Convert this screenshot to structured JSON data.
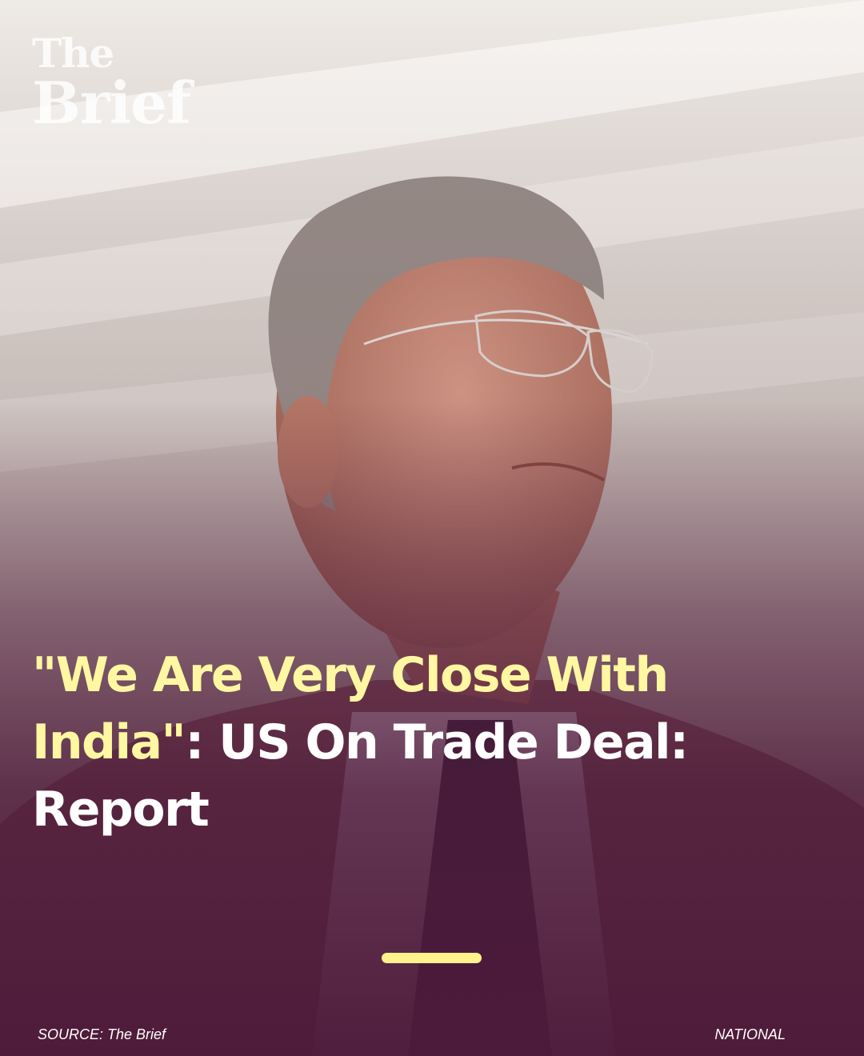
{
  "brand": {
    "line1": "The",
    "line2": "Brief"
  },
  "headline": {
    "highlight": "\"We Are Very Close With India\"",
    "rest": ": US On Trade Deal: Report"
  },
  "footer": {
    "source": "SOURCE: The Brief",
    "category": "NATIONAL"
  },
  "colors": {
    "highlight": "#fff7a1",
    "accent_bar": "#fff28d",
    "overlay": "#4d1a3a"
  }
}
